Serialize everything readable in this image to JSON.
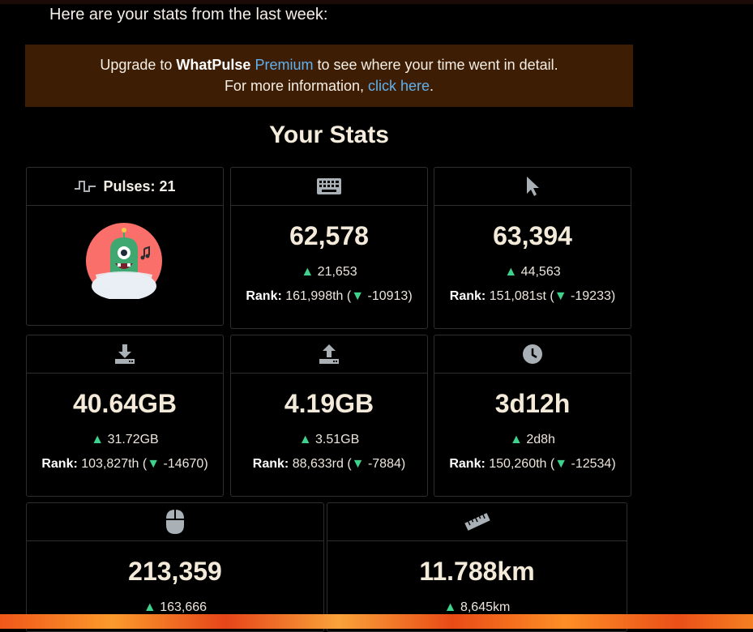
{
  "intro_text": "Here are your stats from the last week:",
  "banner": {
    "prefix": "Upgrade to ",
    "brand": "WhatPulse",
    "space": " ",
    "premium": "Premium",
    "suffix": " to see where your time went in detail.",
    "line2_prefix": "For more information, ",
    "link": "click here",
    "line2_suffix": "."
  },
  "section_title": "Your Stats",
  "pulses": {
    "label": "Pulses: 21"
  },
  "cards": {
    "keys": {
      "icon": "keyboard-icon",
      "value": "62,578",
      "delta": "21,653",
      "rank_label": "Rank:",
      "rank_value": "161,998th (",
      "rank_delta": "-10913)"
    },
    "clicks": {
      "icon": "cursor-icon",
      "value": "63,394",
      "delta": "44,563",
      "rank_label": "Rank:",
      "rank_value": "151,081st (",
      "rank_delta": "-19233)"
    },
    "download": {
      "icon": "download-icon",
      "value": "40.64GB",
      "delta": "31.72GB",
      "rank_label": "Rank:",
      "rank_value": "103,827th (",
      "rank_delta": "-14670)"
    },
    "upload": {
      "icon": "upload-icon",
      "value": "4.19GB",
      "delta": "3.51GB",
      "rank_label": "Rank:",
      "rank_value": "88,633rd (",
      "rank_delta": "-7884)"
    },
    "uptime": {
      "icon": "clock-icon",
      "value": "3d12h",
      "delta": "2d8h",
      "rank_label": "Rank:",
      "rank_value": "150,260th (",
      "rank_delta": "-12534)"
    },
    "scrolls": {
      "icon": "mouse-icon",
      "value": "213,359",
      "delta": "163,666"
    },
    "distance": {
      "icon": "ruler-icon",
      "value": "11.788km",
      "delta": "8,645km"
    }
  },
  "arrows": {
    "up": "▲",
    "down": "▼"
  },
  "colors": {
    "accent_link": "#5fb1ef",
    "banner_bg": "#3e1d05",
    "up_arrow": "#3fd28c"
  }
}
